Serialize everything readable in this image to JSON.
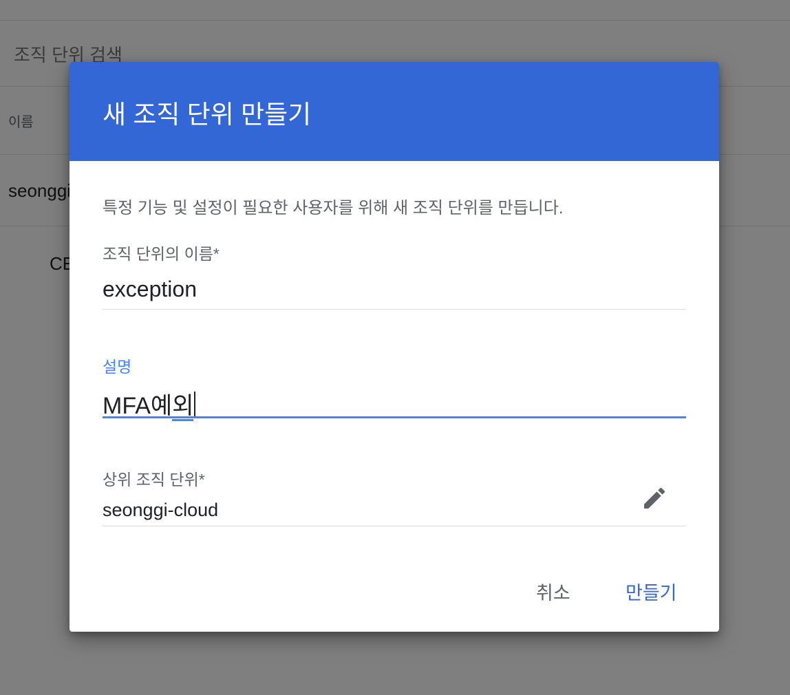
{
  "background": {
    "search_placeholder": "조직 단위 검색",
    "column_name": "이름",
    "row_name": "seonggi",
    "row_sub": "CE"
  },
  "dialog": {
    "title": "새 조직 단위 만들기",
    "description": "특정 기능 및 설정이 필요한 사용자를 위해 새 조직 단위를 만듭니다.",
    "name_field": {
      "label": "조직 단위의 이름*",
      "value": "exception"
    },
    "description_field": {
      "label": "설명",
      "value_committed": "MFA예",
      "value_composing": "외"
    },
    "parent_field": {
      "label": "상위 조직 단위*",
      "value": "seonggi-cloud",
      "icon": "pencil-edit-icon"
    },
    "actions": {
      "cancel_label": "취소",
      "create_label": "만들기"
    }
  },
  "colors": {
    "header": "#3367d6",
    "focus": "#4285f4",
    "scrim": "rgba(0,0,0,0.5)"
  }
}
